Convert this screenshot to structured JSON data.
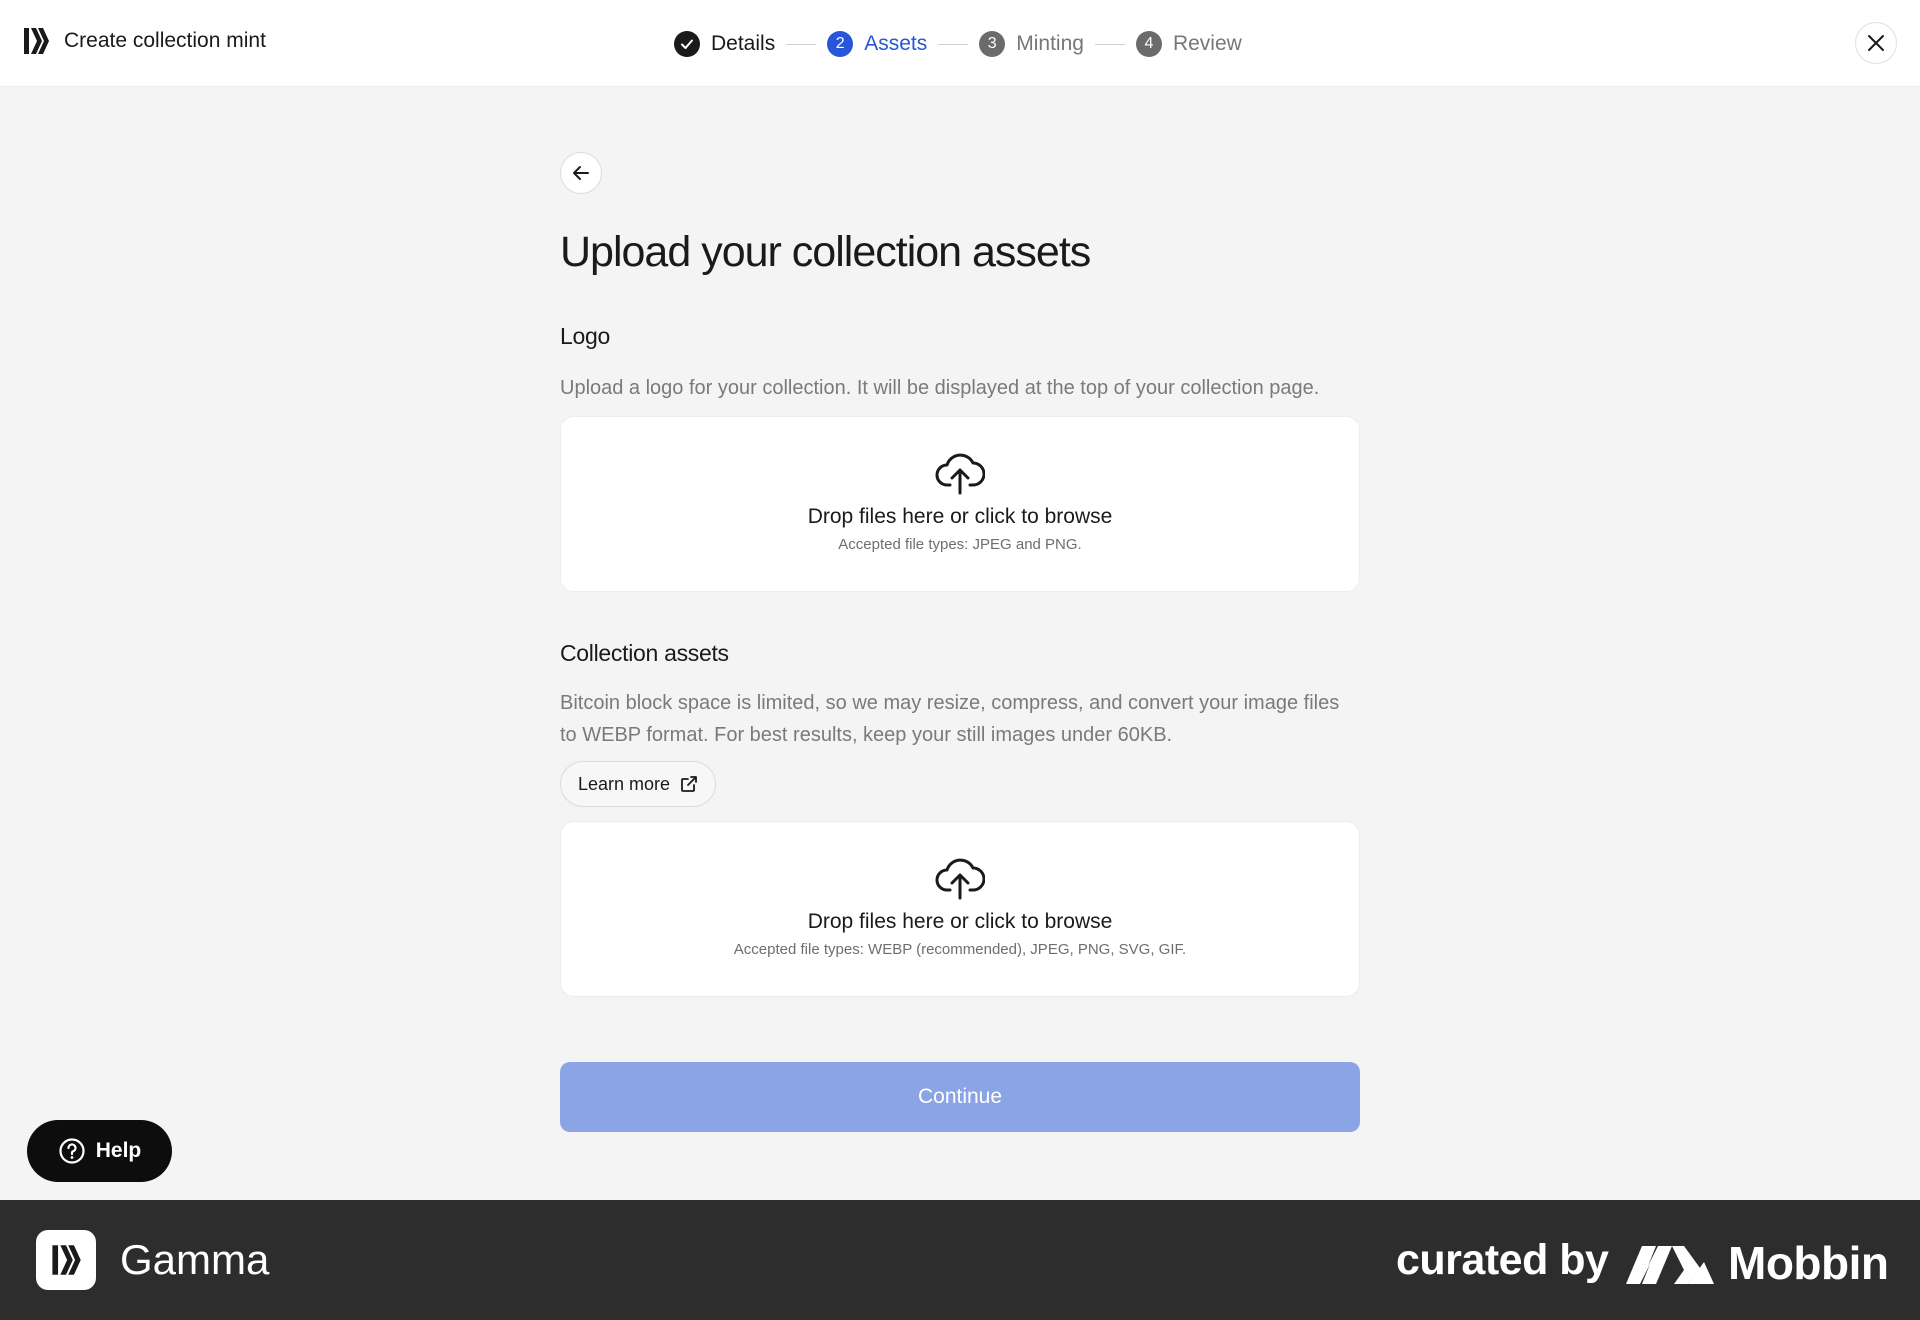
{
  "header": {
    "title": "Create collection mint",
    "logo_icon": "gamma-logo-icon",
    "close_icon": "close-icon"
  },
  "stepper": {
    "steps": [
      {
        "number": "1",
        "label": "Details",
        "state": "done"
      },
      {
        "number": "2",
        "label": "Assets",
        "state": "active"
      },
      {
        "number": "3",
        "label": "Minting",
        "state": "pending"
      },
      {
        "number": "4",
        "label": "Review",
        "state": "pending"
      }
    ]
  },
  "main": {
    "back_icon": "arrow-left-icon",
    "title": "Upload your collection assets",
    "logo_section": {
      "title": "Logo",
      "description": "Upload a logo for your collection. It will be displayed at the top of your collection page.",
      "dropzone": {
        "label": "Drop files here or click to browse",
        "hint": "Accepted file types: JPEG and PNG."
      }
    },
    "assets_section": {
      "title": "Collection assets",
      "description": "Bitcoin block space is limited, so we may resize, compress, and convert your image files to WEBP format. For best results, keep your still images under 60KB.",
      "learn_more": "Learn more",
      "dropzone": {
        "label": "Drop files here or click to browse",
        "hint": "Accepted file types: WEBP (recommended), JPEG, PNG, SVG, GIF."
      }
    },
    "continue_label": "Continue"
  },
  "help": {
    "label": "Help"
  },
  "footer": {
    "app_name": "Gamma",
    "curated_by": "curated by",
    "brand": "Mobbin"
  },
  "colors": {
    "accent": "#2757d8",
    "continue_disabled": "#8aa4e6",
    "background": "#f4f4f5",
    "footer": "#2d2d2d"
  }
}
